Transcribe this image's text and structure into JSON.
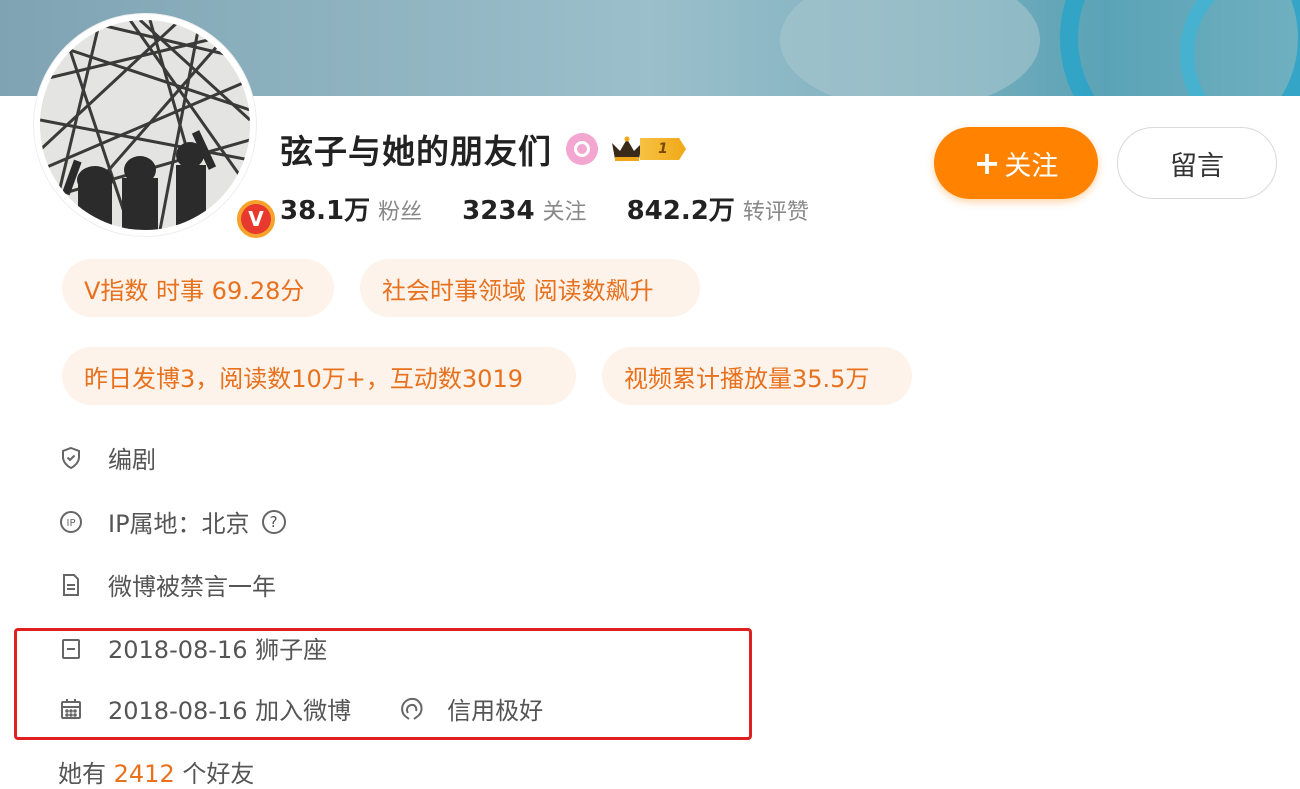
{
  "profile": {
    "name": "弦子与她的朋友们",
    "level": "1",
    "verified_mark": "V",
    "stats": [
      {
        "value": "38.1万",
        "label": "粉丝"
      },
      {
        "value": "3234",
        "label": "关注"
      },
      {
        "value": "842.2万",
        "label": "转评赞"
      }
    ]
  },
  "actions": {
    "follow_plus": "+",
    "follow_label": "关注",
    "message_label": "留言"
  },
  "tags": [
    "V指数 时事 69.28分",
    "社会时事领域 阅读数飙升",
    "昨日发博3，阅读数10万+，互动数3019",
    "视频累计播放量35.5万"
  ],
  "info": {
    "occupation": "编剧",
    "ip_location": "IP属地：北京",
    "help_mark": "?",
    "status": "微博被禁言一年",
    "birthday": "2018-08-16 狮子座",
    "joined": "2018-08-16 加入微博",
    "credit": "信用极好"
  },
  "friends": {
    "prefix": "她有",
    "count": "2412",
    "suffix": "个好友"
  },
  "colors": {
    "follow": "#ff8200",
    "tag_text": "#e8711e",
    "tag_bg": "#fdf3ea",
    "highlight": "#e02020"
  },
  "icons": [
    "shield-icon",
    "ip-icon",
    "document-icon",
    "date-icon",
    "calendar-icon",
    "credit-icon",
    "crown-icon",
    "gender-female-icon",
    "verified-icon"
  ]
}
